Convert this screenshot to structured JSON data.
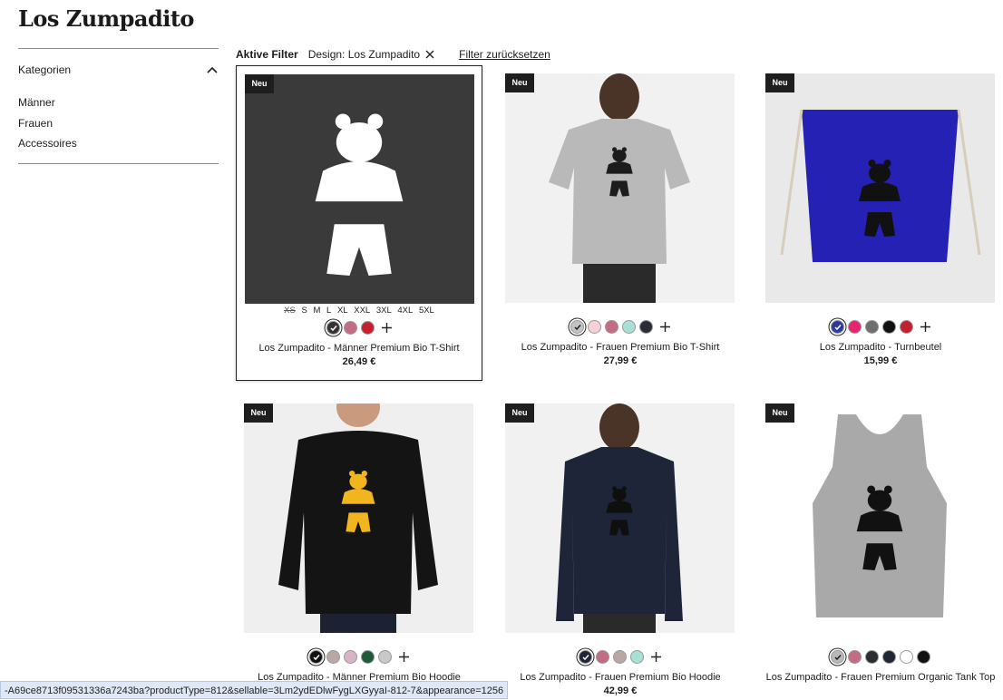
{
  "page": {
    "title": "Los Zumpadito"
  },
  "sidebar": {
    "heading": "Kategorien",
    "items": [
      {
        "label": "Männer"
      },
      {
        "label": "Frauen"
      },
      {
        "label": "Accessoires"
      }
    ]
  },
  "filters": {
    "label": "Aktive Filter",
    "chip": "Design: Los Zumpadito",
    "reset": "Filter zurücksetzen"
  },
  "products": [
    {
      "badge": "Neu",
      "name": "Los Zumpadito - Männer Premium Bio T-Shirt",
      "price": "26,49 €",
      "sizes": [
        "XS",
        "S",
        "M",
        "L",
        "XL",
        "XXL",
        "3XL",
        "4XL",
        "5XL"
      ],
      "swatches": [
        "#333333",
        "#c46b86",
        "#c42032"
      ],
      "selected_swatch": 0,
      "garment_color": "#3a3a3a",
      "print_color": "#ffffff"
    },
    {
      "badge": "Neu",
      "name": "Los Zumpadito - Frauen Premium Bio T-Shirt",
      "price": "27,99 €",
      "swatches": [
        "#c3c3c3",
        "#f7d1d6",
        "#c46b86",
        "#a7e1d6",
        "#2b2d33"
      ],
      "selected_swatch": 0,
      "garment_color": "#b9b9b9",
      "print_color": "#1c1c1c"
    },
    {
      "badge": "Neu",
      "name": "Los Zumpadito - Turnbeutel",
      "price": "15,99 €",
      "swatches": [
        "#2c3a9c",
        "#e6246f",
        "#6e6e6e",
        "#111111",
        "#c42032"
      ],
      "selected_swatch": 0,
      "garment_color": "#2421b4",
      "print_color": "#111111"
    },
    {
      "badge": "Neu",
      "name": "Los Zumpadito - Männer Premium Bio Hoodie",
      "price": "",
      "swatches": [
        "#111111",
        "#b9a7a4",
        "#d9b3c4",
        "#1f5b38",
        "#c8c8c8"
      ],
      "selected_swatch": 0,
      "garment_color": "#141414",
      "print_color": "#f0b51f"
    },
    {
      "badge": "Neu",
      "name": "Los Zumpadito - Frauen Premium Bio Hoodie",
      "price": "42,99 €",
      "swatches": [
        "#1f2638",
        "#c46b86",
        "#b9a7a4",
        "#a7e1d6"
      ],
      "selected_swatch": 0,
      "garment_color": "#1e2538",
      "print_color": "#0f0f0f"
    },
    {
      "badge": "Neu",
      "name": "Los Zumpadito - Frauen Premium Organic Tank Top",
      "price": "",
      "swatches": [
        "#b9b9b9",
        "#c46b86",
        "#2b2d33",
        "#1f2638",
        "#ffffff",
        "#111111"
      ],
      "selected_swatch": 0,
      "garment_color": "#a9a9a9",
      "print_color": "#111111"
    }
  ],
  "statusbar": {
    "text": "-A69ce8713f09531336a7243ba?productType=812&sellable=3Lm2ydEDlwFygLXGyyaI-812-7&appearance=1256"
  }
}
